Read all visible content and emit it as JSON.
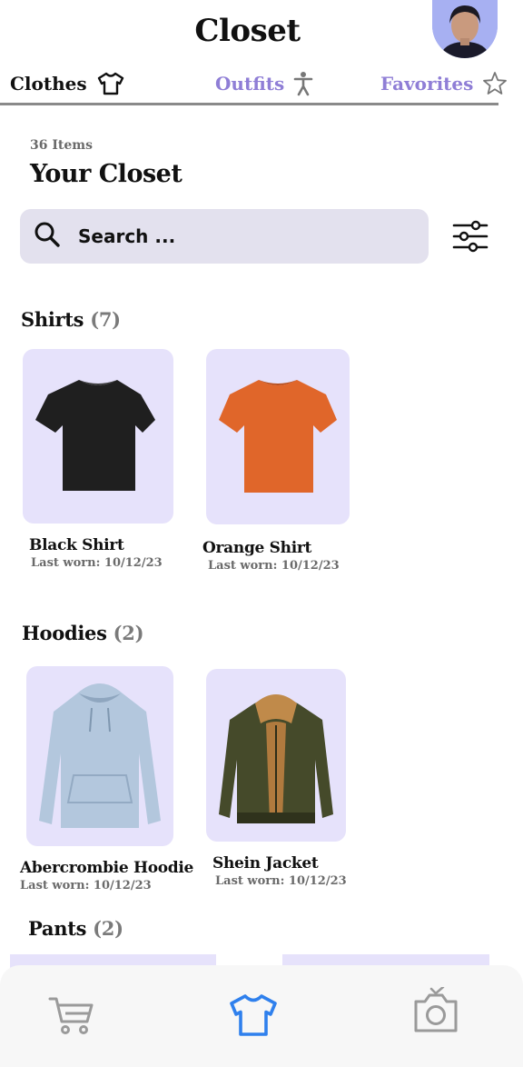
{
  "header": {
    "title": "Closet"
  },
  "tabs": [
    {
      "label": "Clothes",
      "icon": "shirt-icon",
      "active": true
    },
    {
      "label": "Outfits",
      "icon": "person-icon",
      "active": false
    },
    {
      "label": "Favorites",
      "icon": "star-icon",
      "active": false
    }
  ],
  "summary": {
    "count_label": "36 Items",
    "heading": "Your Closet"
  },
  "search": {
    "placeholder": "Search ..."
  },
  "sections": {
    "shirts": {
      "name": "Shirts",
      "count": "(7)",
      "items": [
        {
          "name": "Black Shirt",
          "worn": "Last worn: 10/12/23",
          "color": "#1f1f1f"
        },
        {
          "name": "Orange Shirt",
          "worn": "Last worn: 10/12/23",
          "color": "#e0662a"
        }
      ]
    },
    "hoodies": {
      "name": "Hoodies",
      "count": "(2)",
      "items": [
        {
          "name": "Abercrombie Hoodie",
          "worn": "Last worn: 10/12/23",
          "color": "#b3c7dd"
        },
        {
          "name": "Shein Jacket",
          "worn": "Last worn: 10/12/23",
          "color": "#454a2a"
        }
      ]
    },
    "pants": {
      "name": "Pants",
      "count": "(2)"
    }
  },
  "bottom_nav": [
    {
      "icon": "cart-icon",
      "active": false
    },
    {
      "icon": "shirt-icon",
      "active": true
    },
    {
      "icon": "camera-icon",
      "active": false
    }
  ],
  "colors": {
    "accent": "#8f7ed6",
    "card_bg": "#e6e2fb",
    "search_bg": "#e3e1ee",
    "nav_active": "#2f80ed",
    "nav_inactive": "#9a9a9a"
  }
}
